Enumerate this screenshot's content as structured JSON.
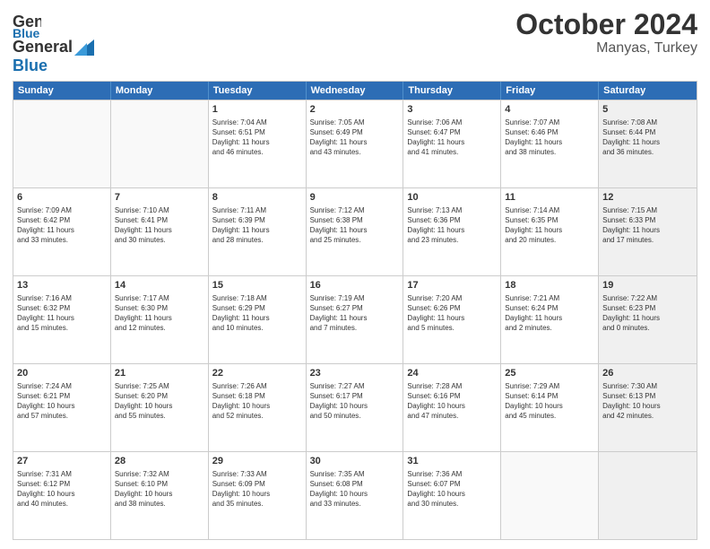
{
  "header": {
    "logo_line1": "General",
    "logo_line2": "Blue",
    "title": "October 2024",
    "subtitle": "Manyas, Turkey"
  },
  "days_of_week": [
    "Sunday",
    "Monday",
    "Tuesday",
    "Wednesday",
    "Thursday",
    "Friday",
    "Saturday"
  ],
  "weeks": [
    [
      {
        "day": "",
        "empty": true
      },
      {
        "day": "",
        "empty": true
      },
      {
        "day": "1",
        "line1": "Sunrise: 7:04 AM",
        "line2": "Sunset: 6:51 PM",
        "line3": "Daylight: 11 hours",
        "line4": "and 46 minutes."
      },
      {
        "day": "2",
        "line1": "Sunrise: 7:05 AM",
        "line2": "Sunset: 6:49 PM",
        "line3": "Daylight: 11 hours",
        "line4": "and 43 minutes."
      },
      {
        "day": "3",
        "line1": "Sunrise: 7:06 AM",
        "line2": "Sunset: 6:47 PM",
        "line3": "Daylight: 11 hours",
        "line4": "and 41 minutes."
      },
      {
        "day": "4",
        "line1": "Sunrise: 7:07 AM",
        "line2": "Sunset: 6:46 PM",
        "line3": "Daylight: 11 hours",
        "line4": "and 38 minutes."
      },
      {
        "day": "5",
        "line1": "Sunrise: 7:08 AM",
        "line2": "Sunset: 6:44 PM",
        "line3": "Daylight: 11 hours",
        "line4": "and 36 minutes.",
        "shaded": true
      }
    ],
    [
      {
        "day": "6",
        "line1": "Sunrise: 7:09 AM",
        "line2": "Sunset: 6:42 PM",
        "line3": "Daylight: 11 hours",
        "line4": "and 33 minutes."
      },
      {
        "day": "7",
        "line1": "Sunrise: 7:10 AM",
        "line2": "Sunset: 6:41 PM",
        "line3": "Daylight: 11 hours",
        "line4": "and 30 minutes."
      },
      {
        "day": "8",
        "line1": "Sunrise: 7:11 AM",
        "line2": "Sunset: 6:39 PM",
        "line3": "Daylight: 11 hours",
        "line4": "and 28 minutes."
      },
      {
        "day": "9",
        "line1": "Sunrise: 7:12 AM",
        "line2": "Sunset: 6:38 PM",
        "line3": "Daylight: 11 hours",
        "line4": "and 25 minutes."
      },
      {
        "day": "10",
        "line1": "Sunrise: 7:13 AM",
        "line2": "Sunset: 6:36 PM",
        "line3": "Daylight: 11 hours",
        "line4": "and 23 minutes."
      },
      {
        "day": "11",
        "line1": "Sunrise: 7:14 AM",
        "line2": "Sunset: 6:35 PM",
        "line3": "Daylight: 11 hours",
        "line4": "and 20 minutes."
      },
      {
        "day": "12",
        "line1": "Sunrise: 7:15 AM",
        "line2": "Sunset: 6:33 PM",
        "line3": "Daylight: 11 hours",
        "line4": "and 17 minutes.",
        "shaded": true
      }
    ],
    [
      {
        "day": "13",
        "line1": "Sunrise: 7:16 AM",
        "line2": "Sunset: 6:32 PM",
        "line3": "Daylight: 11 hours",
        "line4": "and 15 minutes."
      },
      {
        "day": "14",
        "line1": "Sunrise: 7:17 AM",
        "line2": "Sunset: 6:30 PM",
        "line3": "Daylight: 11 hours",
        "line4": "and 12 minutes."
      },
      {
        "day": "15",
        "line1": "Sunrise: 7:18 AM",
        "line2": "Sunset: 6:29 PM",
        "line3": "Daylight: 11 hours",
        "line4": "and 10 minutes."
      },
      {
        "day": "16",
        "line1": "Sunrise: 7:19 AM",
        "line2": "Sunset: 6:27 PM",
        "line3": "Daylight: 11 hours",
        "line4": "and 7 minutes."
      },
      {
        "day": "17",
        "line1": "Sunrise: 7:20 AM",
        "line2": "Sunset: 6:26 PM",
        "line3": "Daylight: 11 hours",
        "line4": "and 5 minutes."
      },
      {
        "day": "18",
        "line1": "Sunrise: 7:21 AM",
        "line2": "Sunset: 6:24 PM",
        "line3": "Daylight: 11 hours",
        "line4": "and 2 minutes."
      },
      {
        "day": "19",
        "line1": "Sunrise: 7:22 AM",
        "line2": "Sunset: 6:23 PM",
        "line3": "Daylight: 11 hours",
        "line4": "and 0 minutes.",
        "shaded": true
      }
    ],
    [
      {
        "day": "20",
        "line1": "Sunrise: 7:24 AM",
        "line2": "Sunset: 6:21 PM",
        "line3": "Daylight: 10 hours",
        "line4": "and 57 minutes."
      },
      {
        "day": "21",
        "line1": "Sunrise: 7:25 AM",
        "line2": "Sunset: 6:20 PM",
        "line3": "Daylight: 10 hours",
        "line4": "and 55 minutes."
      },
      {
        "day": "22",
        "line1": "Sunrise: 7:26 AM",
        "line2": "Sunset: 6:18 PM",
        "line3": "Daylight: 10 hours",
        "line4": "and 52 minutes."
      },
      {
        "day": "23",
        "line1": "Sunrise: 7:27 AM",
        "line2": "Sunset: 6:17 PM",
        "line3": "Daylight: 10 hours",
        "line4": "and 50 minutes."
      },
      {
        "day": "24",
        "line1": "Sunrise: 7:28 AM",
        "line2": "Sunset: 6:16 PM",
        "line3": "Daylight: 10 hours",
        "line4": "and 47 minutes."
      },
      {
        "day": "25",
        "line1": "Sunrise: 7:29 AM",
        "line2": "Sunset: 6:14 PM",
        "line3": "Daylight: 10 hours",
        "line4": "and 45 minutes."
      },
      {
        "day": "26",
        "line1": "Sunrise: 7:30 AM",
        "line2": "Sunset: 6:13 PM",
        "line3": "Daylight: 10 hours",
        "line4": "and 42 minutes.",
        "shaded": true
      }
    ],
    [
      {
        "day": "27",
        "line1": "Sunrise: 7:31 AM",
        "line2": "Sunset: 6:12 PM",
        "line3": "Daylight: 10 hours",
        "line4": "and 40 minutes."
      },
      {
        "day": "28",
        "line1": "Sunrise: 7:32 AM",
        "line2": "Sunset: 6:10 PM",
        "line3": "Daylight: 10 hours",
        "line4": "and 38 minutes."
      },
      {
        "day": "29",
        "line1": "Sunrise: 7:33 AM",
        "line2": "Sunset: 6:09 PM",
        "line3": "Daylight: 10 hours",
        "line4": "and 35 minutes."
      },
      {
        "day": "30",
        "line1": "Sunrise: 7:35 AM",
        "line2": "Sunset: 6:08 PM",
        "line3": "Daylight: 10 hours",
        "line4": "and 33 minutes."
      },
      {
        "day": "31",
        "line1": "Sunrise: 7:36 AM",
        "line2": "Sunset: 6:07 PM",
        "line3": "Daylight: 10 hours",
        "line4": "and 30 minutes."
      },
      {
        "day": "",
        "empty": true
      },
      {
        "day": "",
        "empty": true,
        "shaded": true
      }
    ]
  ]
}
